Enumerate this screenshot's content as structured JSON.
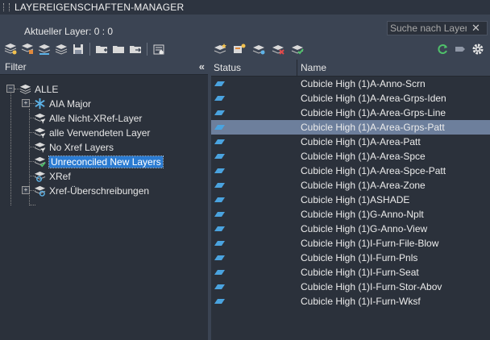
{
  "window": {
    "title": "LAYEREIGENSCHAFTEN-MANAGER"
  },
  "current_layer": "Aktueller Layer: 0 : 0",
  "search": {
    "placeholder": "Suche nach Layer",
    "clear_icon": "close-icon"
  },
  "filter_panel": {
    "header": "Filter",
    "collapse_icon": "double-chevron-left-icon",
    "tree": [
      {
        "label": "ALLE",
        "icon": "layer-stack-icon",
        "expanded": true
      },
      {
        "label": "AIA Major",
        "icon": "snowflake-filter-icon",
        "expanded": false
      },
      {
        "label": "Alle Nicht-XRef-Layer",
        "icon": "filter-icon"
      },
      {
        "label": "alle Verwendeten Layer",
        "icon": "filter-icon"
      },
      {
        "label": "No Xref Layers",
        "icon": "filter-icon"
      },
      {
        "label": "Unreconciled New Layers",
        "icon": "filter-check-icon",
        "selected": true
      },
      {
        "label": "XRef",
        "icon": "xref-icon",
        "expanded": false
      },
      {
        "label": "Xref-Überschreibungen",
        "icon": "xref-override-icon"
      }
    ]
  },
  "layer_table": {
    "columns": [
      "Status",
      "Name"
    ],
    "rows": [
      {
        "name": "Cubicle High (1)A-Anno-Scrn"
      },
      {
        "name": "Cubicle High (1)A-Area-Grps-Iden"
      },
      {
        "name": "Cubicle High (1)A-Area-Grps-Line"
      },
      {
        "name": "Cubicle High (1)A-Area-Grps-Patt",
        "selected": true
      },
      {
        "name": "Cubicle High (1)A-Area-Patt"
      },
      {
        "name": "Cubicle High (1)A-Area-Spce"
      },
      {
        "name": "Cubicle High (1)A-Area-Spce-Patt"
      },
      {
        "name": "Cubicle High (1)A-Area-Zone"
      },
      {
        "name": "Cubicle High (1)ASHADE"
      },
      {
        "name": "Cubicle High (1)G-Anno-Nplt"
      },
      {
        "name": "Cubicle High (1)G-Anno-View"
      },
      {
        "name": "Cubicle High (1)I-Furn-File-Blow"
      },
      {
        "name": "Cubicle High (1)I-Furn-Pnls"
      },
      {
        "name": "Cubicle High (1)I-Furn-Seat"
      },
      {
        "name": "Cubicle High (1)I-Furn-Stor-Abov"
      },
      {
        "name": "Cubicle High (1)I-Furn-Wksf"
      }
    ]
  },
  "colors": {
    "panel_bg": "#2b313b",
    "chrome_bg": "#3b4453",
    "selection_blue": "#2b7bd1",
    "row_selection": "#6d7f9c",
    "layer_status_icon": "#4aa3df",
    "refresh_green": "#4fc06a"
  }
}
